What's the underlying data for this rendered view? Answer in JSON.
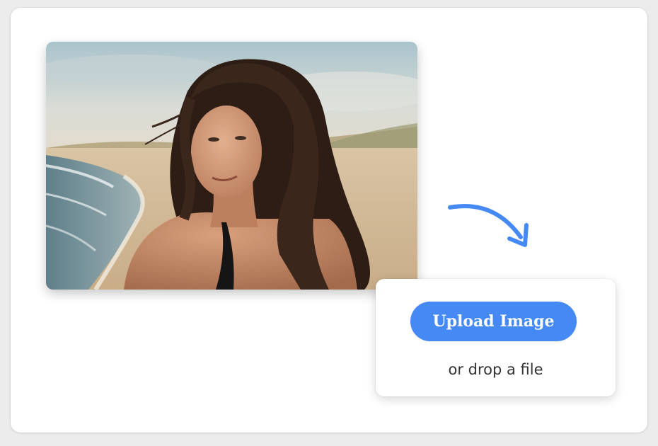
{
  "upload": {
    "button_label": "Upload Image",
    "drop_text": "or drop a file"
  },
  "preview": {
    "icon": "arrow-curved-down-right-icon"
  },
  "colors": {
    "accent": "#4589f5",
    "background": "#ffffff",
    "drop_text": "#333333"
  }
}
